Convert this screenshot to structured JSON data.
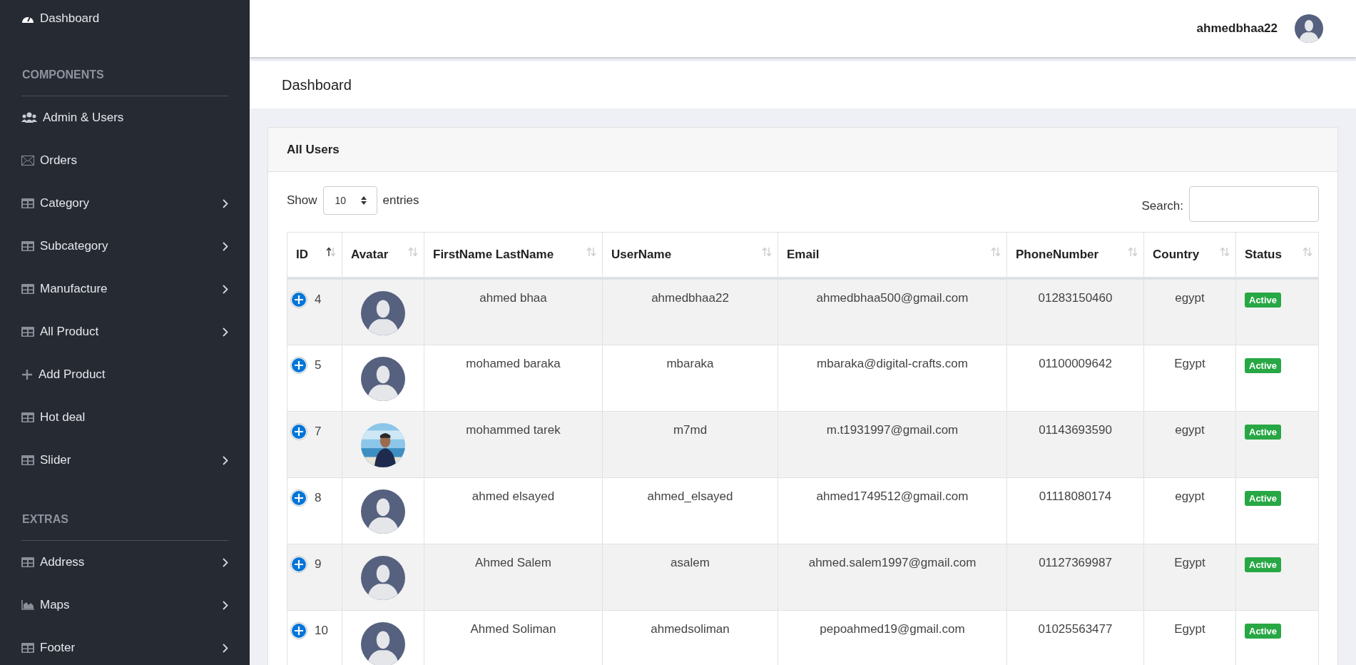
{
  "sidebar": {
    "sections": [
      {
        "items": [
          {
            "label": "Dashboard",
            "expandable": false
          }
        ]
      },
      {
        "title": "COMPONENTS",
        "items": [
          {
            "label": "Admin & Users",
            "expandable": false
          },
          {
            "label": "Orders",
            "expandable": false
          },
          {
            "label": "Category",
            "expandable": true
          },
          {
            "label": "Subcategory",
            "expandable": true
          },
          {
            "label": "Manufacture",
            "expandable": true
          },
          {
            "label": "All Product",
            "expandable": true
          },
          {
            "label": "Add Product",
            "expandable": false
          },
          {
            "label": "Hot deal",
            "expandable": false
          },
          {
            "label": "Slider",
            "expandable": true
          }
        ]
      },
      {
        "title": "EXTRAS",
        "items": [
          {
            "label": "Address",
            "expandable": true
          },
          {
            "label": "Maps",
            "expandable": true
          },
          {
            "label": "Footer",
            "expandable": true
          }
        ]
      }
    ]
  },
  "header": {
    "username": "ahmedbhaa22"
  },
  "page_title": "Dashboard",
  "card": {
    "title": "All Users",
    "length": {
      "before": "Show",
      "value": "10",
      "after": "entries"
    },
    "search": {
      "label": "Search:"
    },
    "table": {
      "columns": [
        {
          "label": "ID",
          "sorted": true
        },
        {
          "label": "Avatar",
          "sorted": false
        },
        {
          "label": "FirstName LastName",
          "sorted": false
        },
        {
          "label": "UserName",
          "sorted": false
        },
        {
          "label": "Email",
          "sorted": false
        },
        {
          "label": "PhoneNumber",
          "sorted": false
        },
        {
          "label": "Country",
          "sorted": false
        },
        {
          "label": "Status",
          "sorted": false
        }
      ],
      "rows": [
        {
          "id": "4",
          "photo": false,
          "name": "ahmed bhaa",
          "username": "ahmedbhaa22",
          "email": "ahmedbhaa500@gmail.com",
          "phone": "01283150460",
          "country": "egypt",
          "status": "Active"
        },
        {
          "id": "5",
          "photo": false,
          "name": "mohamed baraka",
          "username": "mbaraka",
          "email": "mbaraka@digital-crafts.com",
          "phone": "01100009642",
          "country": "Egypt",
          "status": "Active"
        },
        {
          "id": "7",
          "photo": true,
          "name": "mohammed tarek",
          "username": "m7md",
          "email": "m.t1931997@gmail.com",
          "phone": "01143693590",
          "country": "egypt",
          "status": "Active"
        },
        {
          "id": "8",
          "photo": false,
          "name": "ahmed elsayed",
          "username": "ahmed_elsayed",
          "email": "ahmed1749512@gmail.com",
          "phone": "01118080174",
          "country": "egypt",
          "status": "Active"
        },
        {
          "id": "9",
          "photo": false,
          "name": "Ahmed Salem",
          "username": "asalem",
          "email": "ahmed.salem1997@gmail.com",
          "phone": "01127369987",
          "country": "Egypt",
          "status": "Active"
        },
        {
          "id": "10",
          "photo": false,
          "name": "Ahmed Soliman",
          "username": "ahmedsoliman",
          "email": "pepoahmed19@gmail.com",
          "phone": "01025563477",
          "country": "Egypt",
          "status": "Active"
        }
      ]
    }
  }
}
